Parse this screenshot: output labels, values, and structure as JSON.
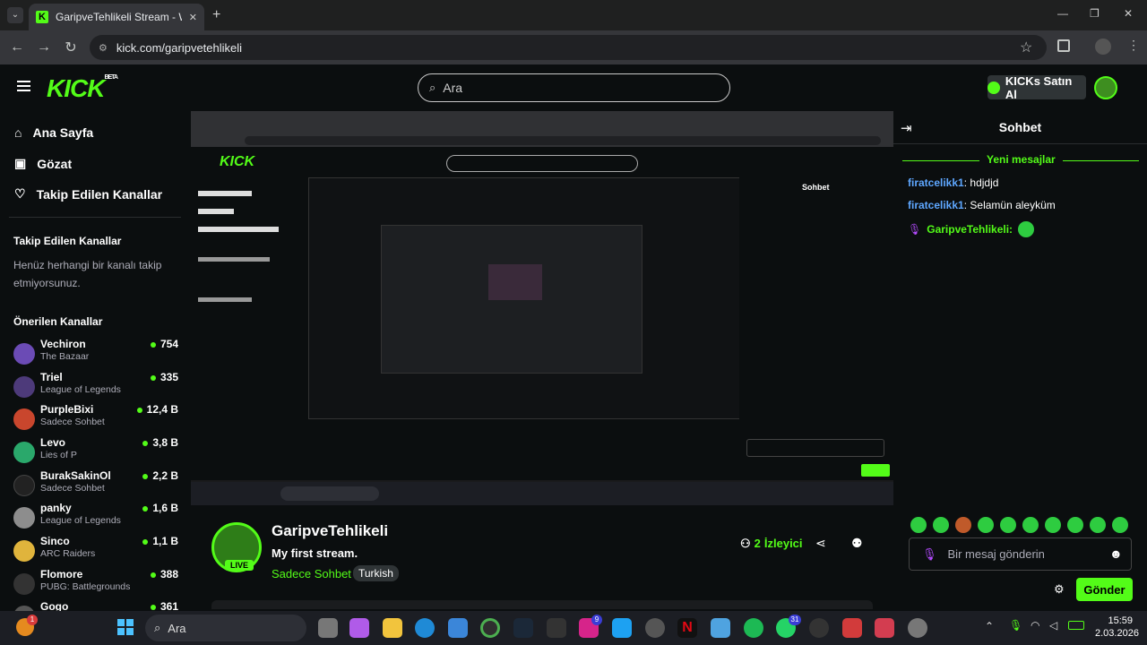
{
  "browser": {
    "tab_title": "GaripveTehlikeli Stream - Watch",
    "url": "kick.com/garipvetehlikeli",
    "new_tab": "+",
    "win_min": "—",
    "win_max": "❐",
    "win_close": "✕"
  },
  "header": {
    "logo": "KICK",
    "logo_badge": "BETA",
    "search_placeholder": "Ara",
    "kicks_button": "KICKs Satın Al"
  },
  "sidebar": {
    "nav": [
      {
        "label": "Ana Sayfa",
        "icon": "home-icon"
      },
      {
        "label": "Gözat",
        "icon": "browse-icon"
      },
      {
        "label": "Takip Edilen Kanallar",
        "icon": "heart-icon"
      }
    ],
    "following_title": "Takip Edilen Kanallar",
    "following_empty": "Henüz herhangi bir kanalı takip etmiyorsunuz.",
    "recommended_title": "Önerilen Kanallar",
    "channels": [
      {
        "name": "Vechiron",
        "category": "The Bazaar",
        "viewers": "754",
        "color": "#6b4bb5"
      },
      {
        "name": "Triel",
        "category": "League of Legends",
        "viewers": "335",
        "color": "#4d3a7a"
      },
      {
        "name": "PurpleBixi",
        "category": "Sadece Sohbet",
        "viewers": "12,4 B",
        "color": "#c9462d"
      },
      {
        "name": "Levo",
        "category": "Lies of P",
        "viewers": "3,8 B",
        "color": "#2aa86b"
      },
      {
        "name": "BurakSakinOl",
        "category": "Sadece Sohbet",
        "viewers": "2,2 B",
        "color": "#222"
      },
      {
        "name": "panky",
        "category": "League of Legends",
        "viewers": "1,6 B",
        "color": "#8d8d8d"
      },
      {
        "name": "Sinco",
        "category": "ARC Raiders",
        "viewers": "1,1 B",
        "color": "#e0b43c"
      },
      {
        "name": "Flomore",
        "category": "PUBG: Battlegrounds",
        "viewers": "388",
        "color": "#333"
      },
      {
        "name": "Gogo",
        "category": "",
        "viewers": "361",
        "color": "#555"
      }
    ]
  },
  "stream": {
    "channel_name": "GaripveTehlikeli",
    "title": "My first stream.",
    "category": "Sadece Sohbet",
    "tag": "Turkish",
    "live_badge": "LIVE",
    "viewers_count": "2",
    "viewers_label": "İzleyici"
  },
  "chat": {
    "title": "Sohbet",
    "new_messages": "Yeni mesajlar",
    "messages": [
      {
        "user": "firatcelikk1",
        "text": "hdjdjd"
      },
      {
        "user": "firatcelikk1",
        "text": "Selamün aleyküm"
      }
    ],
    "broadcaster": "GaripveTehlikeli:",
    "input_placeholder": "Bir mesaj gönderin",
    "send_button": "Gönder"
  },
  "taskbar": {
    "search": "Ara",
    "time": "15:59",
    "date": "2.03.2026",
    "notif_badge": "1",
    "badge_instagram": "9",
    "badge_whatsapp": "31"
  }
}
